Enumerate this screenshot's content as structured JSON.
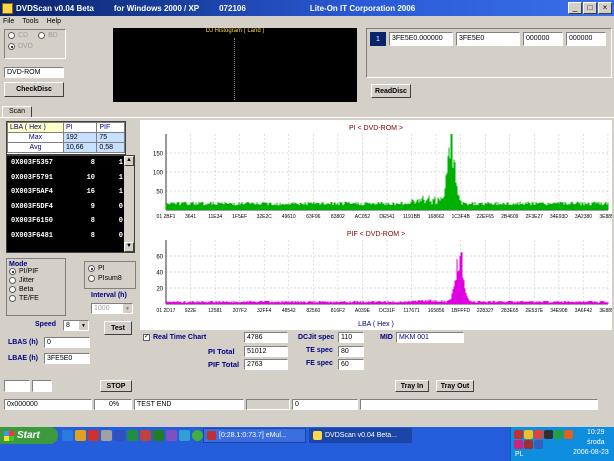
{
  "window": {
    "app": "DVDScan  v0.04 Beta",
    "platform": "for  Windows  2000 / XP",
    "build": "072106",
    "company": "Lite-On IT Corporation  2006",
    "minimize_glyph": "_",
    "restore_glyph": "□",
    "close_glyph": "×"
  },
  "menu": [
    "File",
    "Tools",
    "Help"
  ],
  "disc_type": {
    "options": [
      "CD",
      "BD",
      "DVD"
    ],
    "selected": "DVD"
  },
  "drive_field": "DVD-ROM",
  "check_disc_label": "CheckDisc",
  "histogram_title": "DJ  Histogram  ( Land )",
  "read_disc": {
    "row": [
      "1",
      "3FE5E0.000000",
      "3FE5E0",
      "000000",
      "000000"
    ],
    "button": "ReadDisc"
  },
  "tab_scan": "Scan",
  "stats": {
    "headers": [
      "LBA  ( Hex )",
      "PI",
      "PIF"
    ],
    "rows": [
      {
        "label": "Max",
        "pi": "192",
        "pif": "75"
      },
      {
        "label": "Avg",
        "pi": "10,66",
        "pif": "0,58"
      }
    ]
  },
  "data_rows": [
    [
      "0X003F5357",
      "8",
      "1"
    ],
    [
      "0X003F5791",
      "10",
      "1"
    ],
    [
      "0X003F5AF4",
      "16",
      "1"
    ],
    [
      "0X003F5DF4",
      "9",
      "0"
    ],
    [
      "0X003F6150",
      "8",
      "0"
    ],
    [
      "0X003F6481",
      "8",
      "0"
    ]
  ],
  "mode": {
    "title": "Mode",
    "options": [
      "PI/PIF",
      "Jitter",
      "Beta",
      "TE/FE"
    ],
    "selected": "PI/PIF",
    "sub_options": [
      "PI",
      "PIsum8"
    ],
    "sub_selected": "PI",
    "interval_label": "Interval (h)",
    "interval_value": "1000",
    "speed_label": "Speed",
    "speed_value": "8",
    "test_button": "Test"
  },
  "lbas_label": "LBAS (h)",
  "lbas_value": "0",
  "lbae_label": "LBAE (h)",
  "lbae_value": "3FE5E0",
  "pi_chart": {
    "title": "PI          < DVD-ROM >",
    "y_ticks": [
      "150",
      "100",
      "50"
    ],
    "x_ticks": [
      "01 2BF1",
      "3641",
      "11E34",
      "1F5EF",
      "32E2C",
      "49610",
      "63F96",
      "83802",
      "AC052",
      "DE541",
      "1191BB",
      "168662",
      "1C3F4B",
      "22EF65",
      "2B4609",
      "2F3E27",
      "34E93D",
      "3A2380",
      "3E8857"
    ],
    "color": "#00b000"
  },
  "pif_chart": {
    "title": "PIF          < DVD-ROM >",
    "y_ticks": [
      "60",
      "40",
      "20"
    ],
    "x_ticks": [
      "01 2D17",
      "922E",
      "12581",
      "207F2",
      "32FF4",
      "48542",
      "82560",
      "816F2",
      "A039E",
      "DC31F",
      "117671",
      "165856",
      "1BFFFD",
      "228327",
      "283E65",
      "2E537E",
      "34E908",
      "3A6F42",
      "3E8857"
    ],
    "x_title": "LBA  ( Hex )",
    "color": "#e000e0"
  },
  "chart_data": [
    {
      "type": "area",
      "title": "PI          < DVD-ROM >",
      "ylim": [
        0,
        200
      ],
      "series": [
        {
          "name": "PI",
          "max": 192,
          "avg": 10.66
        }
      ]
    },
    {
      "type": "area",
      "title": "PIF          < DVD-ROM >",
      "xlabel": "LBA  ( Hex )",
      "ylim": [
        0,
        70
      ],
      "series": [
        {
          "name": "PIF",
          "max": 75,
          "avg": 0.58
        }
      ]
    }
  ],
  "realtime": {
    "checkbox_label": "Real Time Chart",
    "checked": true,
    "count": "4786",
    "pi_total_label": "PI    Total",
    "pi_total": "51012",
    "pif_total_label": "PIF  Total",
    "pif_total": "2763",
    "dcjit_label": "DCJit spec",
    "dcjit": "110",
    "te_label": "TE spec",
    "te": "80",
    "fe_label": "FE spec",
    "fe": "60",
    "mid_label": "MID",
    "mid_value": "MKM    001"
  },
  "bottom": {
    "stop": "STOP",
    "tray_in": "Tray In",
    "tray_out": "Tray Out",
    "status_lba": "0x000000",
    "status_percent": "0%",
    "status_text": "TEST END",
    "status_count": "0"
  },
  "taskbar": {
    "start": "Start",
    "items": [
      "[0:28.1:0:73.7] eMul...",
      "DVDScan  v0.04 Beta..."
    ],
    "clock": "10:29",
    "day": "środa",
    "date": "2006-08-23",
    "lang": "PL"
  }
}
